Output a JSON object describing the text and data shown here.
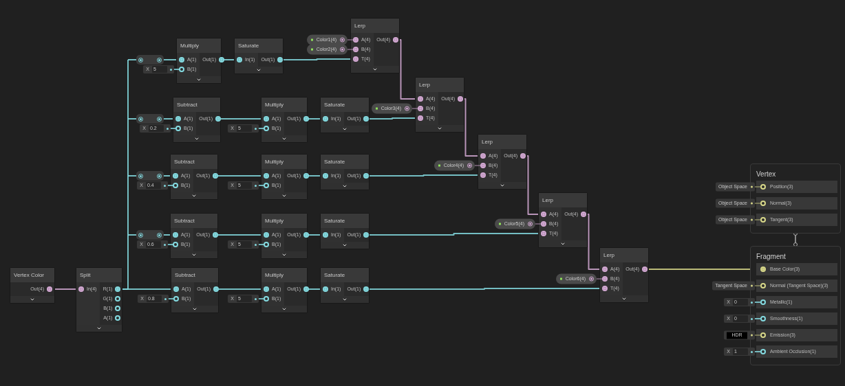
{
  "nodes": [
    {
      "title": "Vertex Color",
      "outputs": [
        {
          "label": "Out(4)",
          "color": "#d4a9d4",
          "connected": true
        }
      ]
    },
    {
      "title": "Split",
      "inputs": [
        {
          "label": "In(4)",
          "color": "#d4a9d4",
          "connected": true
        }
      ],
      "outputs": [
        {
          "label": "R(1)",
          "color": "#84dbe1",
          "connected": true
        },
        {
          "label": "G(1)",
          "color": "#84dbe1",
          "connected": false
        },
        {
          "label": "B(1)",
          "color": "#84dbe1",
          "connected": false
        },
        {
          "label": "A(1)",
          "color": "#84dbe1",
          "connected": false
        }
      ]
    },
    {
      "title": "Multiply",
      "inputs": [
        {
          "label": "A(1)",
          "color": "#84dbe1",
          "connected": true
        },
        {
          "label": "B(1)",
          "color": "#84dbe1",
          "connected": false,
          "default": {
            "kind": "float",
            "prefix": "X",
            "value": "5"
          }
        }
      ],
      "outputs": [
        {
          "label": "Out(1)",
          "color": "#84dbe1",
          "connected": true
        }
      ]
    },
    {
      "title": "Saturate",
      "inputs": [
        {
          "label": "In(1)",
          "color": "#84dbe1",
          "connected": true
        }
      ],
      "outputs": [
        {
          "label": "Out(1)",
          "color": "#84dbe1",
          "connected": true
        }
      ]
    },
    {
      "title": "Lerp",
      "inputs": [
        {
          "label": "A(4)",
          "color": "#d4a9d4",
          "connected": true,
          "property": "Color1(4)"
        },
        {
          "label": "B(4)",
          "color": "#d4a9d4",
          "connected": true,
          "property": "Color2(4)"
        },
        {
          "label": "T(4)",
          "color": "#d4a9d4",
          "connected": true
        }
      ],
      "outputs": [
        {
          "label": "Out(4)",
          "color": "#d4a9d4",
          "connected": true
        }
      ]
    },
    {
      "title": "Subtract",
      "inputs": [
        {
          "label": "A(1)",
          "color": "#84dbe1",
          "connected": true
        },
        {
          "label": "B(1)",
          "color": "#84dbe1",
          "connected": false,
          "default": {
            "kind": "float",
            "prefix": "X",
            "value": "0.2"
          }
        }
      ],
      "outputs": [
        {
          "label": "Out(1)",
          "color": "#84dbe1",
          "connected": true
        }
      ]
    },
    {
      "title": "Multiply",
      "inputs": [
        {
          "label": "A(1)",
          "color": "#84dbe1",
          "connected": true
        },
        {
          "label": "B(1)",
          "color": "#84dbe1",
          "connected": false,
          "default": {
            "kind": "float",
            "prefix": "X",
            "value": "5"
          }
        }
      ],
      "outputs": [
        {
          "label": "Out(1)",
          "color": "#84dbe1",
          "connected": true
        }
      ]
    },
    {
      "title": "Saturate",
      "inputs": [
        {
          "label": "In(1)",
          "color": "#84dbe1",
          "connected": true
        }
      ],
      "outputs": [
        {
          "label": "Out(1)",
          "color": "#84dbe1",
          "connected": true
        }
      ]
    },
    {
      "title": "Lerp",
      "inputs": [
        {
          "label": "A(4)",
          "color": "#d4a9d4",
          "connected": true
        },
        {
          "label": "B(4)",
          "color": "#d4a9d4",
          "connected": true,
          "property": "Color3(4)"
        },
        {
          "label": "T(4)",
          "color": "#d4a9d4",
          "connected": true
        }
      ],
      "outputs": [
        {
          "label": "Out(4)",
          "color": "#d4a9d4",
          "connected": true
        }
      ]
    },
    {
      "title": "Subtract",
      "inputs": [
        {
          "label": "A(1)",
          "color": "#84dbe1",
          "connected": true
        },
        {
          "label": "B(1)",
          "color": "#84dbe1",
          "connected": false,
          "default": {
            "kind": "float",
            "prefix": "X",
            "value": "0.4"
          }
        }
      ],
      "outputs": [
        {
          "label": "Out(1)",
          "color": "#84dbe1",
          "connected": true
        }
      ]
    },
    {
      "title": "Multiply",
      "inputs": [
        {
          "label": "A(1)",
          "color": "#84dbe1",
          "connected": true
        },
        {
          "label": "B(1)",
          "color": "#84dbe1",
          "connected": false,
          "default": {
            "kind": "float",
            "prefix": "X",
            "value": "5"
          }
        }
      ],
      "outputs": [
        {
          "label": "Out(1)",
          "color": "#84dbe1",
          "connected": true
        }
      ]
    },
    {
      "title": "Saturate",
      "inputs": [
        {
          "label": "In(1)",
          "color": "#84dbe1",
          "connected": true
        }
      ],
      "outputs": [
        {
          "label": "Out(1)",
          "color": "#84dbe1",
          "connected": true
        }
      ]
    },
    {
      "title": "Lerp",
      "inputs": [
        {
          "label": "A(4)",
          "color": "#d4a9d4",
          "connected": true
        },
        {
          "label": "B(4)",
          "color": "#d4a9d4",
          "connected": true,
          "property": "Color4(4)"
        },
        {
          "label": "T(4)",
          "color": "#d4a9d4",
          "connected": true
        }
      ],
      "outputs": [
        {
          "label": "Out(4)",
          "color": "#d4a9d4",
          "connected": true
        }
      ]
    },
    {
      "title": "Subtract",
      "inputs": [
        {
          "label": "A(1)",
          "color": "#84dbe1",
          "connected": true
        },
        {
          "label": "B(1)",
          "color": "#84dbe1",
          "connected": false,
          "default": {
            "kind": "float",
            "prefix": "X",
            "value": "0.6"
          }
        }
      ],
      "outputs": [
        {
          "label": "Out(1)",
          "color": "#84dbe1",
          "connected": true
        }
      ]
    },
    {
      "title": "Multiply",
      "inputs": [
        {
          "label": "A(1)",
          "color": "#84dbe1",
          "connected": true
        },
        {
          "label": "B(1)",
          "color": "#84dbe1",
          "connected": false,
          "default": {
            "kind": "float",
            "prefix": "X",
            "value": "5"
          }
        }
      ],
      "outputs": [
        {
          "label": "Out(1)",
          "color": "#84dbe1",
          "connected": true
        }
      ]
    },
    {
      "title": "Saturate",
      "inputs": [
        {
          "label": "In(1)",
          "color": "#84dbe1",
          "connected": true
        }
      ],
      "outputs": [
        {
          "label": "Out(1)",
          "color": "#84dbe1",
          "connected": true
        }
      ]
    },
    {
      "title": "Lerp",
      "inputs": [
        {
          "label": "A(4)",
          "color": "#d4a9d4",
          "connected": true
        },
        {
          "label": "B(4)",
          "color": "#d4a9d4",
          "connected": true,
          "property": "Color5(4)"
        },
        {
          "label": "T(4)",
          "color": "#d4a9d4",
          "connected": true
        }
      ],
      "outputs": [
        {
          "label": "Out(4)",
          "color": "#d4a9d4",
          "connected": true
        }
      ]
    },
    {
      "title": "Subtract",
      "inputs": [
        {
          "label": "A(1)",
          "color": "#84dbe1",
          "connected": true
        },
        {
          "label": "B(1)",
          "color": "#84dbe1",
          "connected": false,
          "default": {
            "kind": "float",
            "prefix": "X",
            "value": "0.8"
          }
        }
      ],
      "outputs": [
        {
          "label": "Out(1)",
          "color": "#84dbe1",
          "connected": true
        }
      ]
    },
    {
      "title": "Multiply",
      "inputs": [
        {
          "label": "A(1)",
          "color": "#84dbe1",
          "connected": true
        },
        {
          "label": "B(1)",
          "color": "#84dbe1",
          "connected": false,
          "default": {
            "kind": "float",
            "prefix": "X",
            "value": "5"
          }
        }
      ],
      "outputs": [
        {
          "label": "Out(1)",
          "color": "#84dbe1",
          "connected": true
        }
      ]
    },
    {
      "title": "Saturate",
      "inputs": [
        {
          "label": "In(1)",
          "color": "#84dbe1",
          "connected": true
        }
      ],
      "outputs": [
        {
          "label": "Out(1)",
          "color": "#84dbe1",
          "connected": true
        }
      ]
    },
    {
      "title": "Lerp",
      "inputs": [
        {
          "label": "A(4)",
          "color": "#d4a9d4",
          "connected": true
        },
        {
          "label": "B(4)",
          "color": "#d4a9d4",
          "connected": true,
          "property": "Color6(4)"
        },
        {
          "label": "T(4)",
          "color": "#d4a9d4",
          "connected": true
        }
      ],
      "outputs": [
        {
          "label": "Out(4)",
          "color": "#d4a9d4",
          "connected": true
        }
      ]
    }
  ],
  "master": [
    {
      "title": "Vertex",
      "slots": [
        {
          "label": "Position(3)",
          "color": "#d8d88a",
          "connected": false,
          "default": {
            "kind": "dropdown",
            "value": "Object Space"
          }
        },
        {
          "label": "Normal(3)",
          "color": "#d8d88a",
          "connected": false,
          "default": {
            "kind": "dropdown",
            "value": "Object Space"
          }
        },
        {
          "label": "Tangent(3)",
          "color": "#d8d88a",
          "connected": false,
          "default": {
            "kind": "dropdown",
            "value": "Object Space"
          }
        }
      ]
    },
    {
      "title": "Fragment",
      "slots": [
        {
          "label": "Base Color(3)",
          "color": "#d8d88a",
          "connected": true
        },
        {
          "label": "Normal (Tangent Space)(3)",
          "color": "#d8d88a",
          "connected": false,
          "default": {
            "kind": "dropdown",
            "value": "Tangent Space"
          }
        },
        {
          "label": "Metallic(1)",
          "color": "#84dbe1",
          "connected": false,
          "default": {
            "kind": "float",
            "prefix": "X",
            "value": "0"
          }
        },
        {
          "label": "Smoothness(1)",
          "color": "#84dbe1",
          "connected": false,
          "default": {
            "kind": "float",
            "prefix": "X",
            "value": "0"
          }
        },
        {
          "label": "Emission(3)",
          "color": "#d8d88a",
          "connected": false,
          "default": {
            "kind": "color",
            "value": "HDR"
          }
        },
        {
          "label": "Ambient Occlusion(1)",
          "color": "#84dbe1",
          "connected": false,
          "default": {
            "kind": "float",
            "prefix": "X",
            "value": "1"
          }
        }
      ]
    }
  ]
}
